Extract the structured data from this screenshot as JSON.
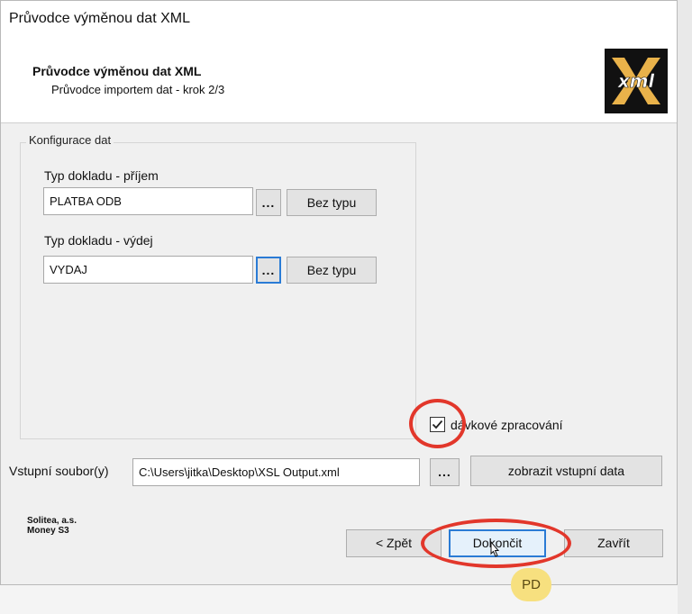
{
  "window": {
    "title": "Průvodce výměnou dat XML"
  },
  "header": {
    "title": "Průvodce výměnou dat XML",
    "subtitle": "Průvodce importem dat - krok 2/3",
    "logo_text": "xml",
    "logo_icon": "xml-logo-icon"
  },
  "config": {
    "group_label": "Konfigurace dat",
    "income": {
      "label": "Typ dokladu - příjem",
      "value": "PLATBA ODB",
      "browse_label": "...",
      "none_label": "Bez typu"
    },
    "expense": {
      "label": "Typ dokladu - výdej",
      "value": "VYDAJ",
      "browse_label": "...",
      "none_label": "Bez typu"
    }
  },
  "batch": {
    "label": "dávkové zpracování",
    "checked": true
  },
  "input": {
    "label": "Vstupní soubor(y)",
    "value": "C:\\Users\\jitka\\Desktop\\XSL Output.xml",
    "browse_label": "...",
    "show_label": "zobrazit vstupní data"
  },
  "footer": {
    "company_line1": "Solitea, a.s.",
    "company_line2": "Money S3",
    "back_label": "< Zpět",
    "finish_label": "Dokončit",
    "close_label": "Zavřít"
  },
  "overlay": {
    "badge": "PD",
    "highlight_color": "#e2372b"
  }
}
